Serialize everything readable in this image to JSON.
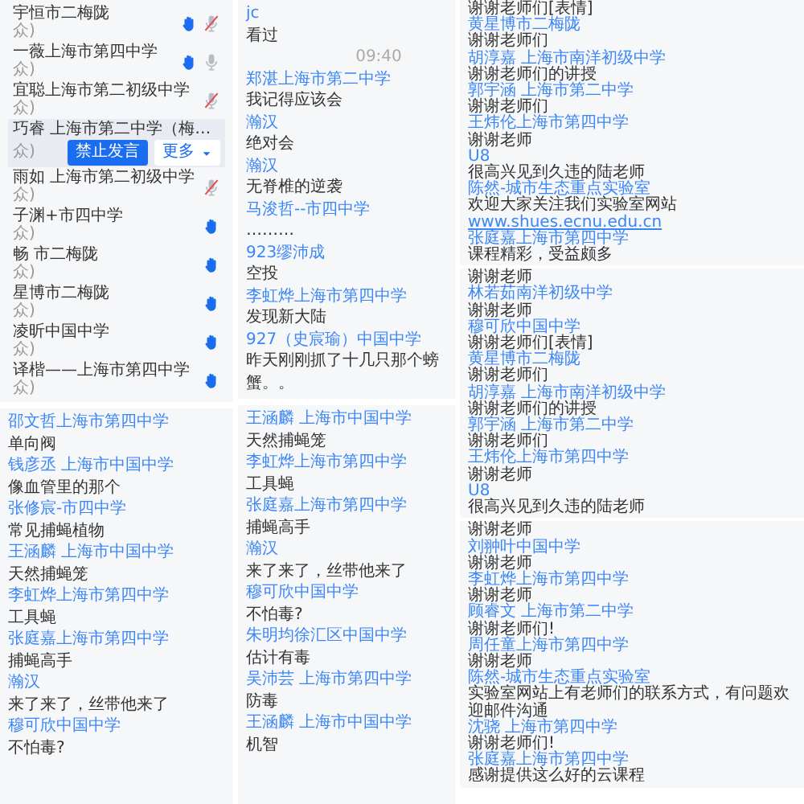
{
  "participants": {
    "rows": [
      {
        "name": "宇恒市二梅陇",
        "role": "众)",
        "hand_raised": true,
        "mic": {
          "muted": true
        },
        "selected": false
      },
      {
        "name": "一薇上海市第四中学",
        "role": "众)",
        "hand_raised": true,
        "mic": {
          "muted": false
        },
        "selected": false
      },
      {
        "name": "宜聪上海市第二初级中学",
        "role": "众)",
        "hand_raised": false,
        "mic": {
          "muted": true
        },
        "selected": false
      },
      {
        "name": "巧睿 上海市第二中学（梅…",
        "role": "众)",
        "hand_raised": false,
        "selected": true,
        "actions": [
          {
            "label": "禁止发言",
            "kind": "primary"
          },
          {
            "label": "更多",
            "kind": "dropdown"
          }
        ]
      },
      {
        "name": "雨如 上海市第二初级中学",
        "role": "众)",
        "hand_raised": false,
        "mic": {
          "muted": true
        },
        "selected": false
      },
      {
        "name": "子渊+市四中学",
        "role": "众)",
        "hand_raised": true,
        "selected": false
      },
      {
        "name": "畅 市二梅陇",
        "role": "众)",
        "hand_raised": true,
        "selected": false
      },
      {
        "name": "星博市二梅陇",
        "role": "众)",
        "hand_raised": true,
        "selected": false
      },
      {
        "name": "凌昕中国中学",
        "role": "众)",
        "hand_raised": true,
        "selected": false
      },
      {
        "name": "译楷——上海市第四中学",
        "role": "众)",
        "hand_raised": true,
        "selected": false
      }
    ]
  },
  "chats": [
    {
      "messages": [
        {
          "kind": "sender",
          "text": "邵文哲上海市第四中学"
        },
        {
          "kind": "text",
          "text": "单向阀"
        },
        {
          "kind": "sender",
          "text": "钱彦丞 上海市中国中学"
        },
        {
          "kind": "text",
          "text": "像血管里的那个"
        },
        {
          "kind": "sender",
          "text": "张修宸-市四中学"
        },
        {
          "kind": "text",
          "text": "常见捕蝇植物"
        },
        {
          "kind": "sender",
          "text": "王涵麟 上海市中国中学"
        },
        {
          "kind": "text",
          "text": "天然捕蝇笼"
        },
        {
          "kind": "sender",
          "text": "李虹烨上海市第四中学"
        },
        {
          "kind": "text",
          "text": "工具蝇"
        },
        {
          "kind": "sender",
          "text": "张庭嘉上海市第四中学"
        },
        {
          "kind": "text",
          "text": "捕蝇高手"
        },
        {
          "kind": "sender",
          "text": "瀚汉"
        },
        {
          "kind": "text",
          "text": "来了来了，丝带他来了"
        },
        {
          "kind": "sender",
          "text": "穆可欣中国中学"
        },
        {
          "kind": "text",
          "text": "不怕毒?"
        }
      ]
    },
    {
      "messages": [
        {
          "kind": "sender",
          "text": "jc"
        },
        {
          "kind": "text",
          "text": "看过"
        },
        {
          "kind": "time",
          "text": "09:40"
        },
        {
          "kind": "sender",
          "text": "郑湛上海市第二中学"
        },
        {
          "kind": "text",
          "text": "我记得应该会"
        },
        {
          "kind": "sender",
          "text": "瀚汉"
        },
        {
          "kind": "text",
          "text": "绝对会"
        },
        {
          "kind": "sender",
          "text": "瀚汉"
        },
        {
          "kind": "text",
          "text": "无脊椎的逆袭"
        },
        {
          "kind": "sender",
          "text": "马浚哲--市四中学"
        },
        {
          "kind": "text",
          "text": "………"
        },
        {
          "kind": "sender",
          "text": "923缪沛成"
        },
        {
          "kind": "text",
          "text": "空投"
        },
        {
          "kind": "sender",
          "text": "李虹烨上海市第四中学"
        },
        {
          "kind": "text",
          "text": "发现新大陆"
        },
        {
          "kind": "sender",
          "text": "927（史宸瑜）中国中学"
        },
        {
          "kind": "text",
          "text": "昨天刚刚抓了十几只那个螃蟹。。"
        }
      ]
    },
    {
      "messages": [
        {
          "kind": "sender",
          "text": "王涵麟 上海市中国中学"
        },
        {
          "kind": "text",
          "text": "天然捕蝇笼"
        },
        {
          "kind": "sender",
          "text": "李虹烨上海市第四中学"
        },
        {
          "kind": "text",
          "text": "工具蝇"
        },
        {
          "kind": "sender",
          "text": "张庭嘉上海市第四中学"
        },
        {
          "kind": "text",
          "text": "捕蝇高手"
        },
        {
          "kind": "sender",
          "text": "瀚汉"
        },
        {
          "kind": "text",
          "text": "来了来了，丝带他来了"
        },
        {
          "kind": "sender",
          "text": "穆可欣中国中学"
        },
        {
          "kind": "text",
          "text": "不怕毒?"
        },
        {
          "kind": "sender",
          "text": "朱明均徐汇区中国中学"
        },
        {
          "kind": "text",
          "text": "估计有毒"
        },
        {
          "kind": "sender",
          "text": "吴沛芸 上海市第四中学"
        },
        {
          "kind": "text",
          "text": "防毒"
        },
        {
          "kind": "sender",
          "text": "王涵麟 上海市中国中学"
        },
        {
          "kind": "text",
          "text": "机智"
        }
      ]
    },
    {
      "messages": [
        {
          "kind": "text",
          "text": "谢谢老师们[表情]"
        },
        {
          "kind": "sender",
          "text": "黄星博市二梅陇"
        },
        {
          "kind": "text",
          "text": "谢谢老师们"
        },
        {
          "kind": "sender",
          "text": "胡淳嘉 上海市南洋初级中学"
        },
        {
          "kind": "text",
          "text": "谢谢老师们的讲授"
        },
        {
          "kind": "sender",
          "text": "郭宇涵 上海市第二中学"
        },
        {
          "kind": "text",
          "text": "谢谢老师们"
        },
        {
          "kind": "sender",
          "text": "王炜伦上海市第四中学"
        },
        {
          "kind": "text",
          "text": "谢谢老师"
        },
        {
          "kind": "sender",
          "text": "U8"
        },
        {
          "kind": "text",
          "text": "很高兴见到久违的陆老师"
        },
        {
          "kind": "sender",
          "text": "陈然-城市生态重点实验室"
        },
        {
          "kind": "text",
          "text": "欢迎大家关注我们实验室网站",
          "link": "www.shues.ecnu.edu.cn"
        },
        {
          "kind": "sender",
          "text": "张庭嘉上海市第四中学"
        },
        {
          "kind": "text",
          "text": "课程精彩，受益颇多"
        }
      ]
    },
    {
      "messages": [
        {
          "kind": "text",
          "text": "谢谢老师"
        },
        {
          "kind": "sender",
          "text": "林若茹南洋初级中学"
        },
        {
          "kind": "text",
          "text": "谢谢老师"
        },
        {
          "kind": "sender",
          "text": "穆可欣中国中学"
        },
        {
          "kind": "text",
          "text": "谢谢老师们[表情]"
        },
        {
          "kind": "sender",
          "text": "黄星博市二梅陇"
        },
        {
          "kind": "text",
          "text": "谢谢老师们"
        },
        {
          "kind": "sender",
          "text": "胡淳嘉 上海市南洋初级中学"
        },
        {
          "kind": "text",
          "text": "谢谢老师们的讲授"
        },
        {
          "kind": "sender",
          "text": "郭宇涵 上海市第二中学"
        },
        {
          "kind": "text",
          "text": "谢谢老师们"
        },
        {
          "kind": "sender",
          "text": "王炜伦上海市第四中学"
        },
        {
          "kind": "text",
          "text": "谢谢老师"
        },
        {
          "kind": "sender",
          "text": "U8"
        },
        {
          "kind": "text",
          "text": "很高兴见到久违的陆老师"
        }
      ]
    },
    {
      "messages": [
        {
          "kind": "text",
          "text": "谢谢老师"
        },
        {
          "kind": "sender",
          "text": "刘翀叶中国中学"
        },
        {
          "kind": "text",
          "text": "谢谢老师"
        },
        {
          "kind": "sender",
          "text": "李虹烨上海市第四中学"
        },
        {
          "kind": "text",
          "text": "谢谢老师"
        },
        {
          "kind": "sender",
          "text": "顾睿文 上海市第二中学"
        },
        {
          "kind": "text",
          "text": "谢谢老师们!"
        },
        {
          "kind": "sender",
          "text": "周任童上海市第四中学"
        },
        {
          "kind": "text",
          "text": "谢谢老师"
        },
        {
          "kind": "sender",
          "text": "陈然-城市生态重点实验室"
        },
        {
          "kind": "text",
          "text": "实验室网站上有老师们的联系方式，有问题欢迎邮件沟通"
        },
        {
          "kind": "sender",
          "text": "沈骁 上海市第四中学"
        },
        {
          "kind": "text",
          "text": "谢谢老师们!"
        },
        {
          "kind": "sender",
          "text": "张庭嘉上海市第四中学"
        },
        {
          "kind": "text",
          "text": "感谢提供这么好的云课程"
        }
      ]
    }
  ]
}
